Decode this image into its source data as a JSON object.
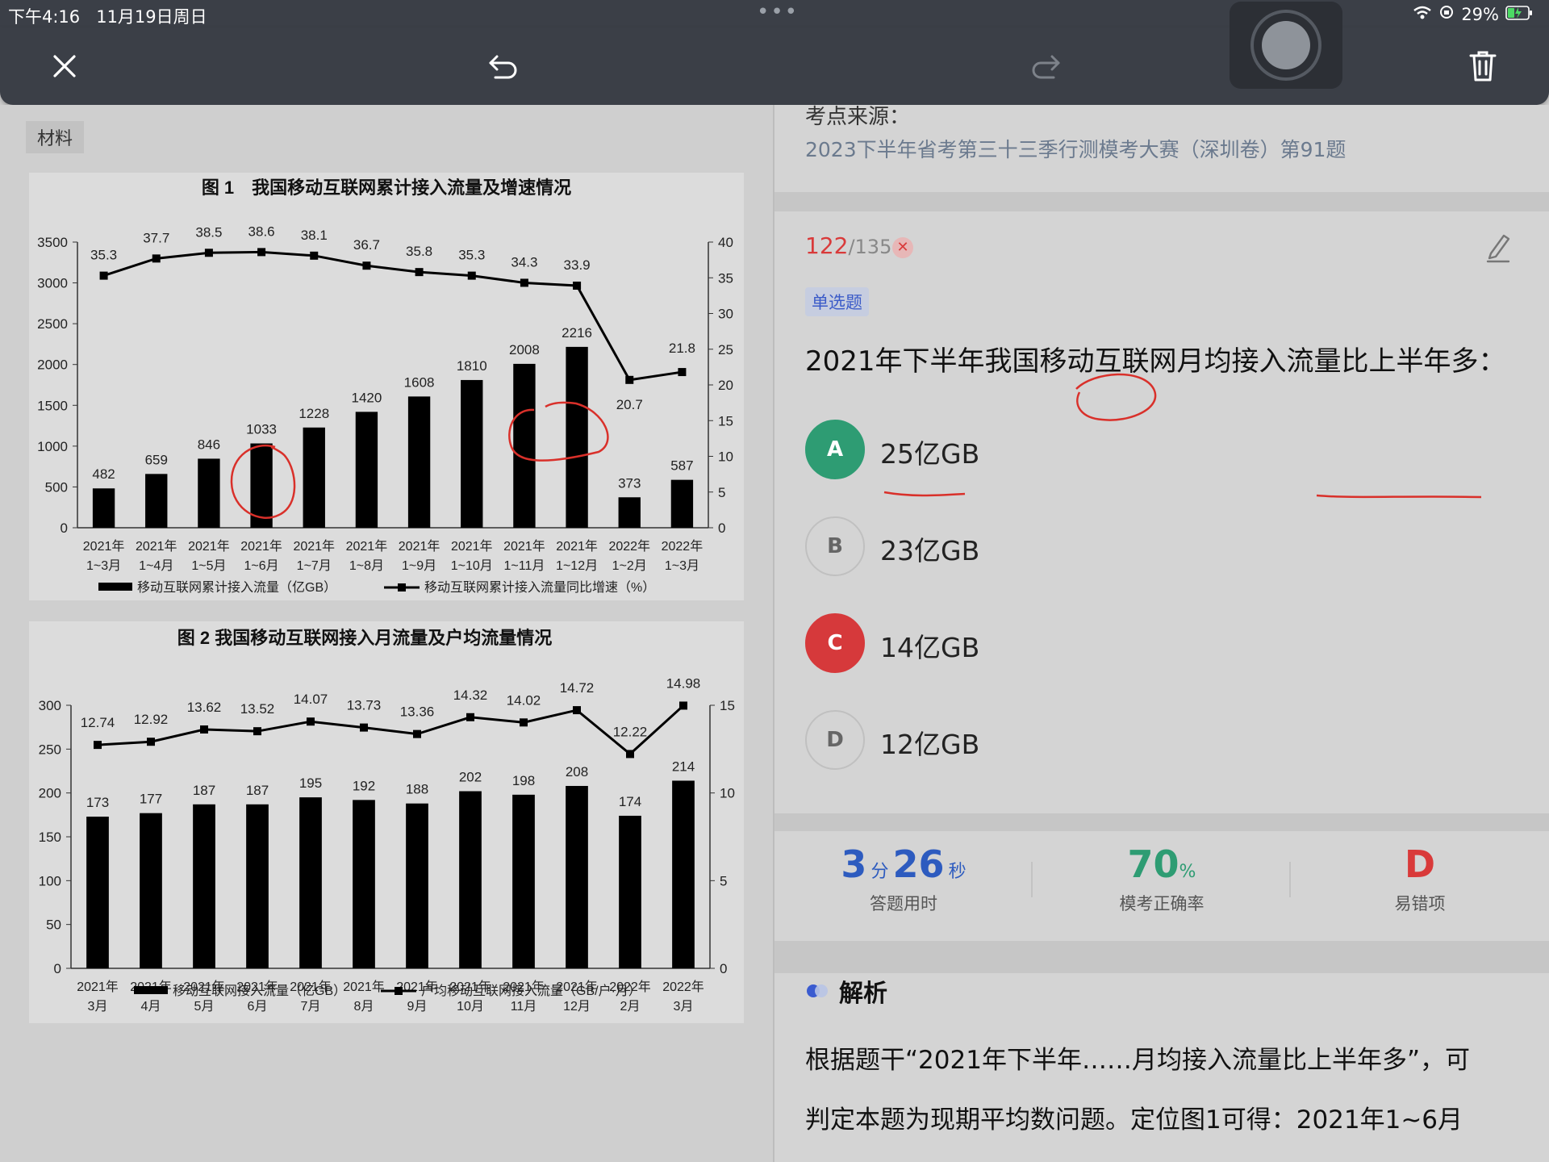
{
  "status": {
    "time": "下午4:16",
    "date": "11月19日周日",
    "battery": "29%"
  },
  "material_label": "材料",
  "chart1_title": "图 1　我国移动互联网累计接入流量及增速情况",
  "chart2_title": "图 2 我国移动互联网接入月流量及户均流量情况",
  "chart_data": [
    {
      "type": "bar",
      "title": "图 1　我国移动互联网累计接入流量及增速情况",
      "categories": [
        "2021年\n1~3月",
        "2021年\n1~4月",
        "2021年\n1~5月",
        "2021年\n1~6月",
        "2021年\n1~7月",
        "2021年\n1~8月",
        "2021年\n1~9月",
        "2021年\n1~10月",
        "2021年\n1~11月",
        "2021年\n1~12月",
        "2022年\n1~2月",
        "2022年\n1~3月"
      ],
      "series": [
        {
          "name": "移动互联网累计接入流量（亿GB）",
          "type": "bar",
          "axis": "left",
          "values": [
            482,
            659,
            846,
            1033,
            1228,
            1420,
            1608,
            1810,
            2008,
            2216,
            373,
            587
          ]
        },
        {
          "name": "移动互联网累计接入流量同比增速（%）",
          "type": "line",
          "axis": "right",
          "values": [
            35.3,
            37.7,
            38.5,
            38.6,
            38.1,
            36.7,
            35.8,
            35.3,
            34.3,
            33.9,
            20.7,
            21.8
          ]
        }
      ],
      "ylim_left": [
        0,
        3500
      ],
      "yticks_left": [
        0,
        500,
        1000,
        1500,
        2000,
        2500,
        3000,
        3500
      ],
      "ylim_right": [
        0,
        40
      ],
      "yticks_right": [
        0,
        5,
        10,
        15,
        20,
        25,
        30,
        35,
        40
      ]
    },
    {
      "type": "bar",
      "title": "图 2 我国移动互联网接入月流量及户均流量情况",
      "categories": [
        "2021年\n3月",
        "2021年\n4月",
        "2021年\n5月",
        "2021年\n6月",
        "2021年\n7月",
        "2021年\n8月",
        "2021年\n9月",
        "2021年\n10月",
        "2021年\n11月",
        "2021年\n12月",
        "2022年\n2月",
        "2022年\n3月"
      ],
      "series": [
        {
          "name": "移动互联网接入流量（亿GB）",
          "type": "bar",
          "axis": "left",
          "values": [
            173,
            177,
            187,
            187,
            195,
            192,
            188,
            202,
            198,
            208,
            174,
            214
          ]
        },
        {
          "name": "户均移动互联网接入流量（GB/户·月）",
          "type": "line",
          "axis": "right",
          "values": [
            12.74,
            12.92,
            13.62,
            13.52,
            14.07,
            13.73,
            13.36,
            14.32,
            14.02,
            14.72,
            12.22,
            14.98
          ]
        }
      ],
      "ylim_left": [
        0,
        300
      ],
      "yticks_left": [
        0,
        50,
        100,
        150,
        200,
        250,
        300
      ],
      "ylim_right": [
        0,
        15
      ],
      "yticks_right": [
        0,
        5,
        10,
        15
      ]
    }
  ],
  "source": {
    "label": "考点来源：",
    "text": "2023下半年省考第三十三季行测模考大赛（深圳卷）第91题"
  },
  "question": {
    "current": "122",
    "total": "/135",
    "type": "单选题",
    "text": "2021年下半年我国移动互联网月均接入流量比上半年多：",
    "options": [
      {
        "letter": "A",
        "text": "25亿GB"
      },
      {
        "letter": "B",
        "text": "23亿GB"
      },
      {
        "letter": "C",
        "text": "14亿GB"
      },
      {
        "letter": "D",
        "text": "12亿GB"
      }
    ]
  },
  "stats": {
    "minutes": "3",
    "min_unit": "分",
    "seconds": "26",
    "sec_unit": "秒",
    "time_label": "答题用时",
    "accuracy": "70",
    "acc_unit": "%",
    "acc_label": "模考正确率",
    "error_option": "D",
    "error_label": "易错项"
  },
  "analysis": {
    "title": "解析",
    "line1": "根据题干“2021年下半年……月均接入流量比上半年多”，可",
    "line2": "判定本题为现期平均数问题。定位图1可得：2021年1~6月"
  },
  "colors": {
    "accent_red": "#d93a3a",
    "accent_green": "#2e9c73",
    "accent_blue": "#2d5bbf",
    "toolbar": "#3b3f47"
  }
}
